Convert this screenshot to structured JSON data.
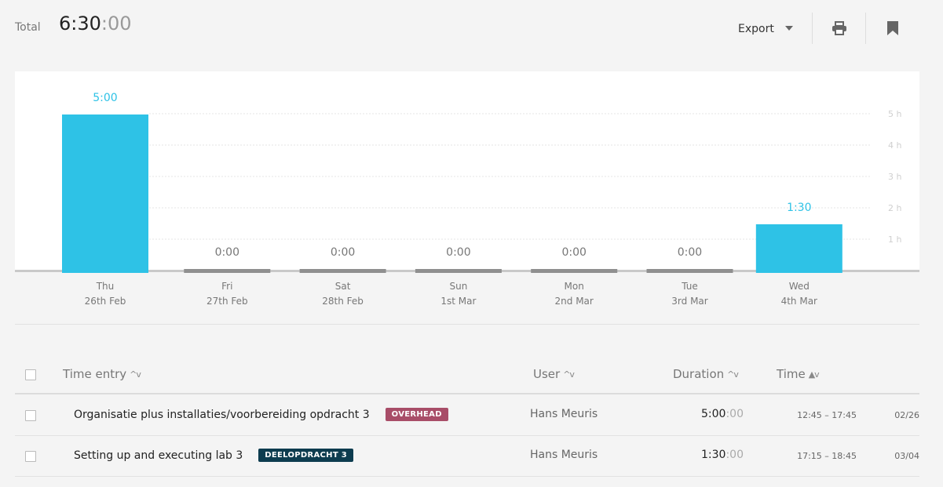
{
  "header": {
    "total_label": "Total",
    "total_hm": "6:30",
    "total_sec": ":00",
    "export_label": "Export",
    "print_icon": "print-icon",
    "bookmark_icon": "bookmark-icon"
  },
  "chart_data": {
    "type": "bar",
    "categories": [
      "Thu 26th Feb",
      "Fri 27th Feb",
      "Sat 28th Feb",
      "Sun 1st Mar",
      "Mon 2nd Mar",
      "Tue 3rd Mar",
      "Wed 4th Mar"
    ],
    "days": [
      {
        "name": "Thu",
        "date": "26th Feb",
        "label": "5:00",
        "hours": 5
      },
      {
        "name": "Fri",
        "date": "27th Feb",
        "label": "0:00",
        "hours": 0
      },
      {
        "name": "Sat",
        "date": "28th Feb",
        "label": "0:00",
        "hours": 0
      },
      {
        "name": "Sun",
        "date": "1st Mar",
        "label": "0:00",
        "hours": 0
      },
      {
        "name": "Mon",
        "date": "2nd Mar",
        "label": "0:00",
        "hours": 0
      },
      {
        "name": "Tue",
        "date": "3rd Mar",
        "label": "0:00",
        "hours": 0
      },
      {
        "name": "Wed",
        "date": "4th Mar",
        "label": "1:30",
        "hours": 1.5
      }
    ],
    "y_ticks": [
      "1 h",
      "2 h",
      "3 h",
      "4 h",
      "5 h"
    ],
    "ylim": [
      0,
      5
    ],
    "bar_color": "#2ec2e6",
    "empty_bar_color": "#8f8f8f",
    "grid": true
  },
  "table": {
    "headers": {
      "entry": "Time entry",
      "user": "User",
      "duration": "Duration",
      "time": "Time"
    },
    "rows": [
      {
        "description": "Organisatie plus installaties/voorbereiding opdracht 3",
        "tag": "OVERHEAD",
        "tag_color": "#a84d68",
        "user": "Hans Meuris",
        "duration_hm": "5:00",
        "duration_sec": ":00",
        "time_range": "12:45 – 17:45",
        "date": "02/26"
      },
      {
        "description": "Setting up and executing lab 3",
        "tag": "DEELOPDRACHT 3",
        "tag_color": "#0d3c4f",
        "user": "Hans Meuris",
        "duration_hm": "1:30",
        "duration_sec": ":00",
        "time_range": "17:15 – 18:45",
        "date": "03/04"
      }
    ]
  }
}
